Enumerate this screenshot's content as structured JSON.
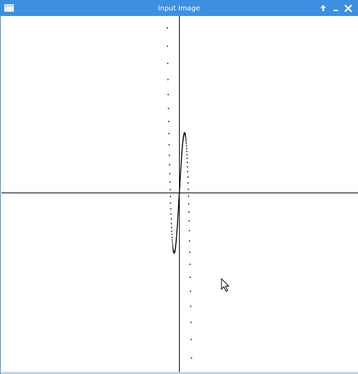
{
  "window": {
    "title": "Input Image",
    "icon": "window-icon",
    "controls": {
      "maximize_icon": "arrow-up-icon",
      "maximize_glyph": "🡑",
      "minimize_icon": "minimize-icon",
      "minimize_glyph": "‗",
      "close_icon": "close-icon",
      "close_glyph": "✕"
    }
  },
  "colors": {
    "titlebar": "#3d8fe2",
    "border": "#3b8de0",
    "canvas_background": "#ffffff",
    "curve": "#000000",
    "axes": "#000000"
  },
  "cursor": {
    "icon": "mouse-pointer-icon"
  }
}
